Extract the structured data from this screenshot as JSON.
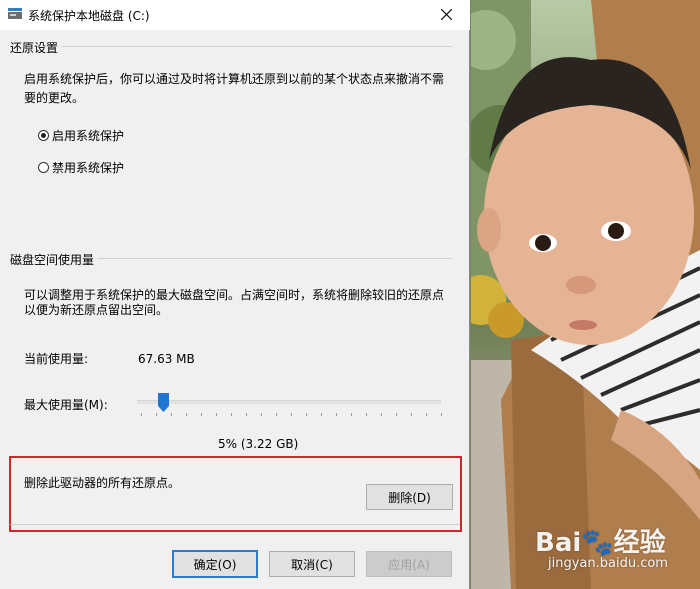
{
  "window": {
    "title": "系统保护本地磁盘 (C:)",
    "close_icon": "close-icon"
  },
  "restore": {
    "heading": "还原设置",
    "description_line1": "启用系统保护后，你可以通过及时将计算机还原到以前的某个状态点来撤消不需",
    "description_line2": "要的更改。",
    "options": [
      {
        "label": "启用系统保护",
        "selected": true
      },
      {
        "label": "禁用系统保护",
        "selected": false
      }
    ]
  },
  "disk": {
    "heading": "磁盘空间使用量",
    "description_line1": "可以调整用于系统保护的最大磁盘空间。占满空间时，系统将删除较旧的还原点",
    "description_line2": "以便为新还原点留出空间。",
    "current_label": "当前使用量:",
    "current_value": "67.63 MB",
    "max_label": "最大使用量(M):",
    "max_value": "5% (3.22 GB)",
    "max_fraction": 0.05
  },
  "delete": {
    "text": "删除此驱动器的所有还原点。",
    "button": "删除(D)"
  },
  "footer": {
    "ok": "确定(O)",
    "cancel": "取消(C)",
    "apply": "应用(A)"
  },
  "watermark": {
    "logo": "Bai🐾经验",
    "url": "jingyan.baidu.com"
  }
}
